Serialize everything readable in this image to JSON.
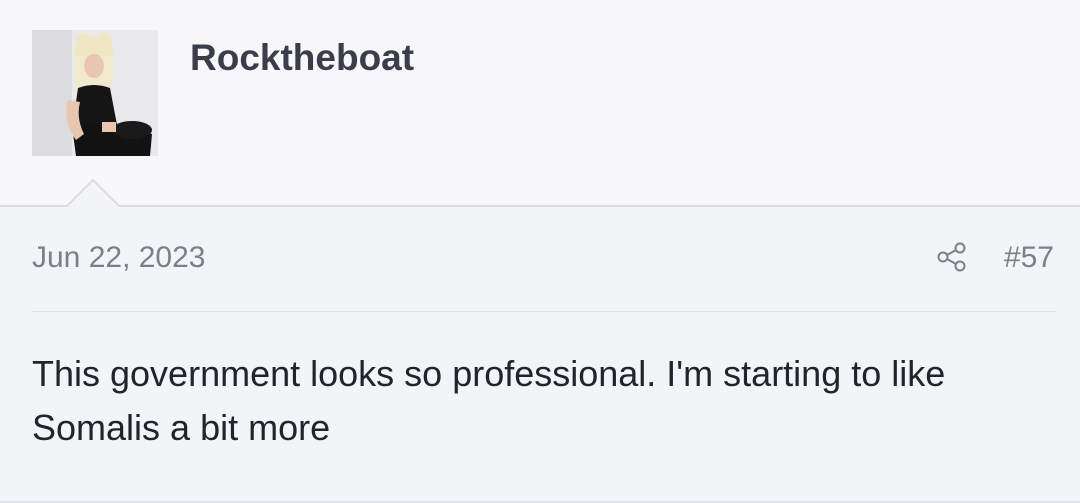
{
  "post": {
    "username": "Rocktheboat",
    "date": "Jun 22, 2023",
    "post_number": "#57",
    "body": "This government looks so professional. I'm starting to like Somalis a bit more",
    "share_icon": "share-nodes-icon"
  },
  "colors": {
    "background": "#f5f6fa",
    "username": "#3b3e4a",
    "muted_text": "#7c7f88",
    "body_text": "#22242b"
  }
}
